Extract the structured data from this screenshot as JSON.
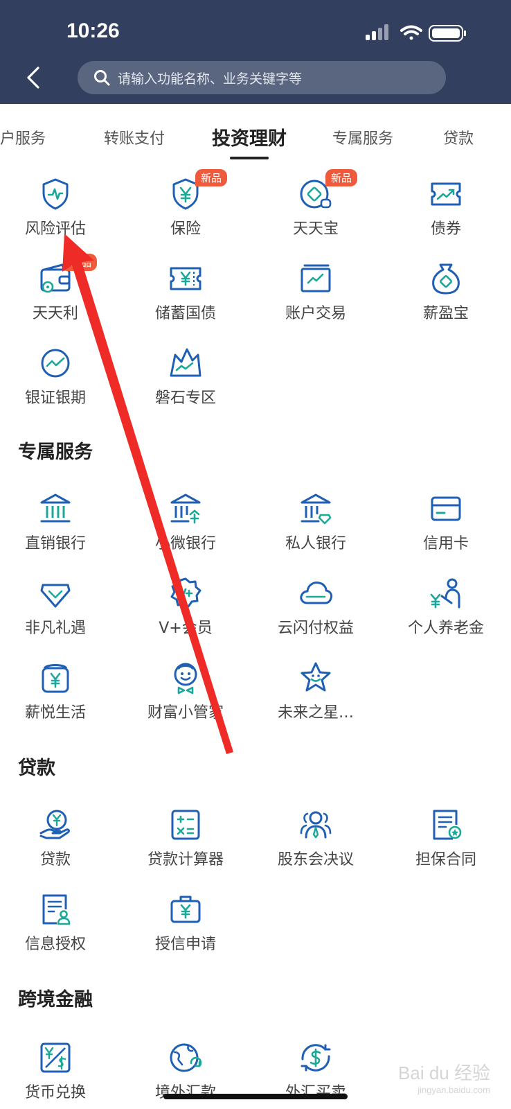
{
  "status": {
    "time": "10:26"
  },
  "header": {
    "search_placeholder": "请输入功能名称、业务关键字等"
  },
  "tabs": [
    {
      "label": "账户服务"
    },
    {
      "label": "转账支付"
    },
    {
      "label": "投资理财"
    },
    {
      "label": "专属服务"
    },
    {
      "label": "贷款"
    }
  ],
  "active_tab": "投资理财",
  "invest": {
    "items": [
      {
        "label": "风险评估",
        "icon": "shield-pulse-icon",
        "badge": ""
      },
      {
        "label": "保险",
        "icon": "shield-yen-icon",
        "badge": "新品"
      },
      {
        "label": "天天宝",
        "icon": "coin-bag-icon",
        "badge": "新品"
      },
      {
        "label": "债券",
        "icon": "bond-chart-icon",
        "badge": ""
      },
      {
        "label": "天天利",
        "icon": "wallet-icon",
        "badge": "新品"
      },
      {
        "label": "储蓄国债",
        "icon": "ticket-yen-icon",
        "badge": ""
      },
      {
        "label": "账户交易",
        "icon": "trading-screen-icon",
        "badge": ""
      },
      {
        "label": "薪盈宝",
        "icon": "money-bag-icon",
        "badge": ""
      },
      {
        "label": "银证银期",
        "icon": "circle-trend-icon",
        "badge": ""
      },
      {
        "label": "磐石专区",
        "icon": "mountain-chart-icon",
        "badge": ""
      }
    ]
  },
  "exclusive": {
    "title": "专属服务",
    "items": [
      {
        "label": "直销银行",
        "icon": "bank-icon"
      },
      {
        "label": "小微银行",
        "icon": "bank-enterprise-icon"
      },
      {
        "label": "私人银行",
        "icon": "bank-diamond-icon"
      },
      {
        "label": "信用卡",
        "icon": "credit-card-icon"
      },
      {
        "label": "非凡礼遇",
        "icon": "diamond-icon"
      },
      {
        "label": "V+会员",
        "icon": "vip-badge-icon"
      },
      {
        "label": "云闪付权益",
        "icon": "unionpay-cloud-icon"
      },
      {
        "label": "个人养老金",
        "icon": "pension-person-icon"
      },
      {
        "label": "薪悦生活",
        "icon": "yen-pouch-icon"
      },
      {
        "label": "财富小管家",
        "icon": "butler-face-icon"
      },
      {
        "label": "未来之星…",
        "icon": "smiling-star-icon"
      }
    ]
  },
  "loans": {
    "title": "贷款",
    "items": [
      {
        "label": "贷款",
        "icon": "hand-yen-icon"
      },
      {
        "label": "贷款计算器",
        "icon": "calculator-icon"
      },
      {
        "label": "股东会决议",
        "icon": "group-people-icon"
      },
      {
        "label": "担保合同",
        "icon": "contract-seal-icon"
      },
      {
        "label": "信息授权",
        "icon": "document-user-icon"
      },
      {
        "label": "授信申请",
        "icon": "briefcase-yen-icon"
      }
    ]
  },
  "crossborder": {
    "title": "跨境金融",
    "items": [
      {
        "label": "货币兑换",
        "icon": "currency-exchange-icon"
      },
      {
        "label": "境外汇款",
        "icon": "globe-transfer-icon"
      },
      {
        "label": "外汇买卖",
        "icon": "dollar-circle-icon"
      }
    ]
  },
  "watermark": {
    "text": "Bai du 经验",
    "sub": "jingyan.baidu.com"
  },
  "colors": {
    "header": "#323f5e",
    "icon_blue": "#1f5fb4",
    "icon_teal": "#1ca79b",
    "badge": "#ef5a3c",
    "annotation_arrow": "#ee2b26"
  }
}
